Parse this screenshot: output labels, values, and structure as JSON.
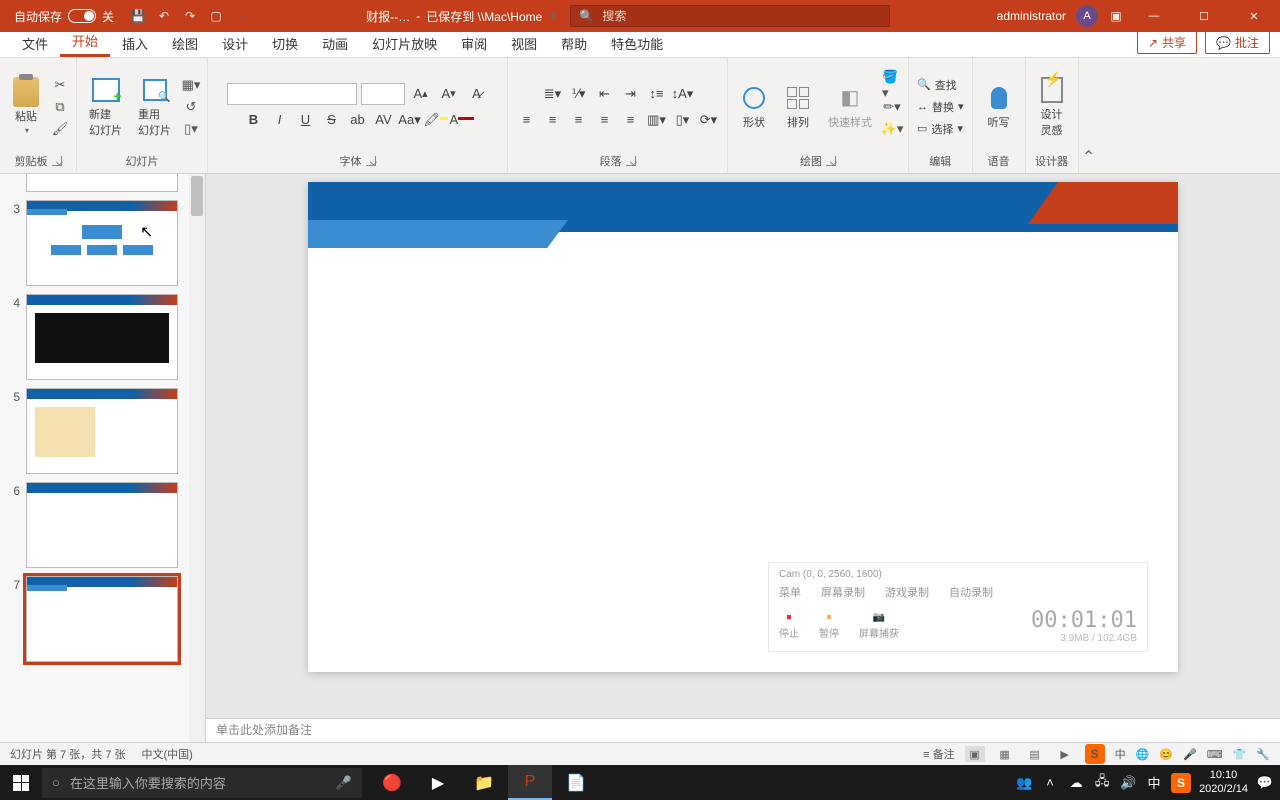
{
  "titlebar": {
    "autosave_label": "自动保存",
    "autosave_state": "关",
    "doc_name": "财报--…",
    "saved_to": "已保存到 \\\\Mac\\Home",
    "search_placeholder": "搜索",
    "user": "administrator",
    "avatar_initial": "A"
  },
  "tabs": {
    "file": "文件",
    "home": "开始",
    "insert": "插入",
    "draw": "绘图",
    "design": "设计",
    "transition": "切换",
    "animation": "动画",
    "slideshow": "幻灯片放映",
    "review": "审阅",
    "view": "视图",
    "help": "帮助",
    "special": "特色功能",
    "share": "共享",
    "comment": "批注"
  },
  "ribbon": {
    "clipboard": {
      "paste": "粘贴",
      "label": "剪贴板"
    },
    "slides": {
      "new_slide": "新建\n幻灯片",
      "reuse": "重用\n幻灯片",
      "label": "幻灯片"
    },
    "font": {
      "label": "字体",
      "bold": "B",
      "italic": "I",
      "underline": "U",
      "strike": "S",
      "shadow": "ab",
      "spacing": "AV",
      "case": "Aa"
    },
    "paragraph": {
      "label": "段落"
    },
    "drawing": {
      "shape": "形状",
      "arrange": "排列",
      "quick": "快速样式",
      "label": "绘图"
    },
    "editing": {
      "find": "查找",
      "replace": "替换",
      "select": "选择",
      "label": "编辑"
    },
    "voice": {
      "dictate": "听写",
      "label": "语音"
    },
    "designer": {
      "ideas": "设计\n灵感",
      "label": "设计器"
    }
  },
  "thumbnails": [
    {
      "n": "3"
    },
    {
      "n": "4"
    },
    {
      "n": "5"
    },
    {
      "n": "6"
    },
    {
      "n": "7"
    }
  ],
  "notes_placeholder": "单击此处添加备注",
  "statusbar": {
    "slide_info": "幻灯片 第 7 张，共 7 张",
    "lang": "中文(中国)",
    "notes_btn": "备注"
  },
  "recorder": {
    "head": "Cam (0, 0, 2560, 1600)",
    "tabs": [
      "菜单",
      "屏幕录制",
      "游戏录制",
      "自动录制"
    ],
    "btns": [
      "停止",
      "暂停",
      "屏幕捕获"
    ],
    "time": "00:01:01",
    "size": "3.9MB / 102.4GB"
  },
  "taskbar": {
    "search_placeholder": "在这里输入你要搜索的内容",
    "ime": "中",
    "time": "10:10",
    "date": "2020/2/14"
  }
}
